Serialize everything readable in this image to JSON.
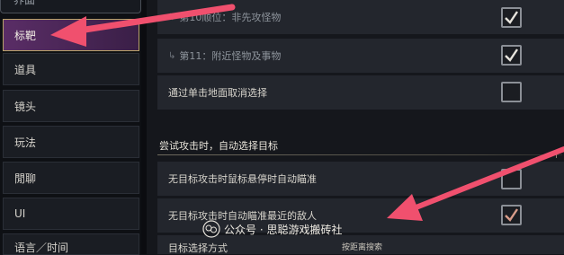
{
  "sidebar": {
    "top_partial": "界面",
    "items": [
      {
        "label": "标靶",
        "active": true
      },
      {
        "label": "道具"
      },
      {
        "label": "镜头"
      },
      {
        "label": "玩法"
      },
      {
        "label": "閒聊"
      },
      {
        "label": "UI"
      },
      {
        "label": "语言／时间"
      }
    ]
  },
  "main": {
    "rows_top": [
      {
        "label": "第10顺位：非先攻怪物",
        "checked": true,
        "sub": true
      },
      {
        "label": "第11：附近怪物及事物",
        "checked": true,
        "sub": true
      },
      {
        "label": "通过单击地面取消选择",
        "checked": false,
        "sub": false
      }
    ],
    "section_title": "尝试攻击时，自动选择目标",
    "rows_section": [
      {
        "label": "无目标攻击时鼠标悬停时自动瞄准",
        "checked": false
      },
      {
        "label": "无目标攻击时自动瞄准最近的敌人",
        "checked": true
      },
      {
        "label": "目标选择方式"
      }
    ],
    "select_value_hint": "按距离搜索"
  },
  "watermark": {
    "text": "公众号 · 思聪游戏搬砖社"
  },
  "colors": {
    "accent_active": "#5a2d66",
    "accent_border": "#b9a26a",
    "annotation_arrow": "#f0506e"
  }
}
